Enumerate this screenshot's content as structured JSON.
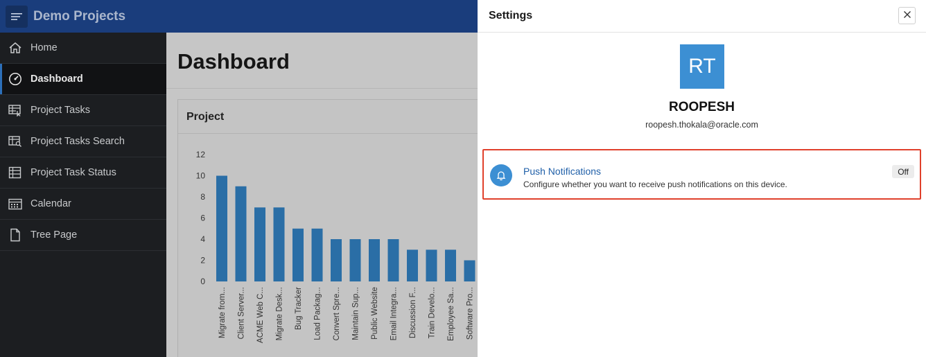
{
  "header": {
    "app_title": "Demo Projects",
    "menu_icon": "hamburger-menu-icon"
  },
  "sidebar": {
    "items": [
      {
        "label": "Home",
        "icon": "home-icon"
      },
      {
        "label": "Dashboard",
        "icon": "dashboard-gauge-icon",
        "active": true
      },
      {
        "label": "Project Tasks",
        "icon": "table-cursor-icon"
      },
      {
        "label": "Project Tasks Search",
        "icon": "table-search-icon"
      },
      {
        "label": "Project Task Status",
        "icon": "table-grid-icon"
      },
      {
        "label": "Calendar",
        "icon": "calendar-icon"
      },
      {
        "label": "Tree Page",
        "icon": "document-icon"
      }
    ]
  },
  "main": {
    "page_title": "Dashboard",
    "region_title": "Project"
  },
  "chart_data": {
    "type": "bar",
    "categories": [
      "Migrate from...",
      "Client Server...",
      "ACME Web C...",
      "Migrate Desk...",
      "Bug Tracker",
      "Load Packag...",
      "Convert Spre...",
      "Maintain Sup...",
      "Public Website",
      "Email Integra...",
      "Discussion F...",
      "Train Develo...",
      "Employee Sa...",
      "Software Pro..."
    ],
    "values": [
      10,
      9,
      7,
      7,
      5,
      5,
      4,
      4,
      4,
      4,
      3,
      3,
      3,
      2
    ],
    "y_ticks": [
      0,
      2,
      4,
      6,
      8,
      10,
      12
    ],
    "ylim": [
      0,
      12
    ],
    "color": "#2a6ea6"
  },
  "settings": {
    "title": "Settings",
    "avatar_initials": "RT",
    "user_name": "ROOPESH",
    "user_email": "roopesh.thokala@oracle.com",
    "push": {
      "title": "Push Notifications",
      "description": "Configure whether you want to receive push notifications on this device.",
      "toggle_label": "Off",
      "icon": "bell-icon"
    },
    "accent_color": "#3c8fd3",
    "highlight_color": "#e0402b"
  }
}
